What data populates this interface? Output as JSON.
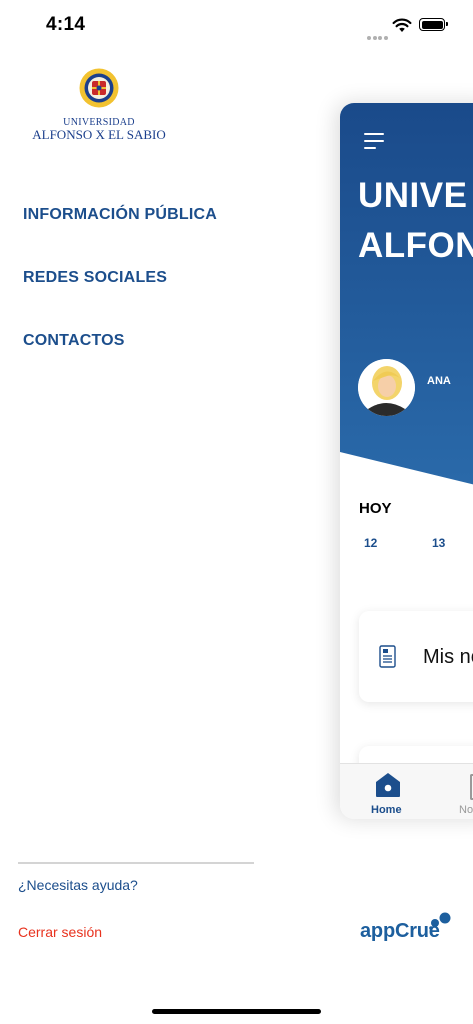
{
  "status_bar": {
    "time": "4:14"
  },
  "logo": {
    "line1": "UNIVERSIDAD",
    "line2": "ALFONSO X EL SABIO"
  },
  "menu": {
    "items": [
      {
        "label": "INFORMACIÓN PÚBLICA"
      },
      {
        "label": "REDES SOCIALES"
      },
      {
        "label": "CONTACTOS"
      }
    ]
  },
  "footer": {
    "help_label": "¿Necesitas ayuda?",
    "logout_label": "Cerrar sesión",
    "brand": "appCrue"
  },
  "app_preview": {
    "title_line1": "UNIVE",
    "title_line2": "ALFON",
    "user_name": "ANA",
    "today_label": "HOY",
    "days": [
      "12",
      "13"
    ],
    "notes_label": "Mis no",
    "tabs": [
      {
        "label": "Home",
        "active": true
      },
      {
        "label": "No",
        "active": false
      }
    ]
  },
  "colors": {
    "menu_text": "#1c4e8c",
    "logout": "#e8321e",
    "hero_blue": "#1b4f8e",
    "brand_blue": "#1d5f9e"
  }
}
